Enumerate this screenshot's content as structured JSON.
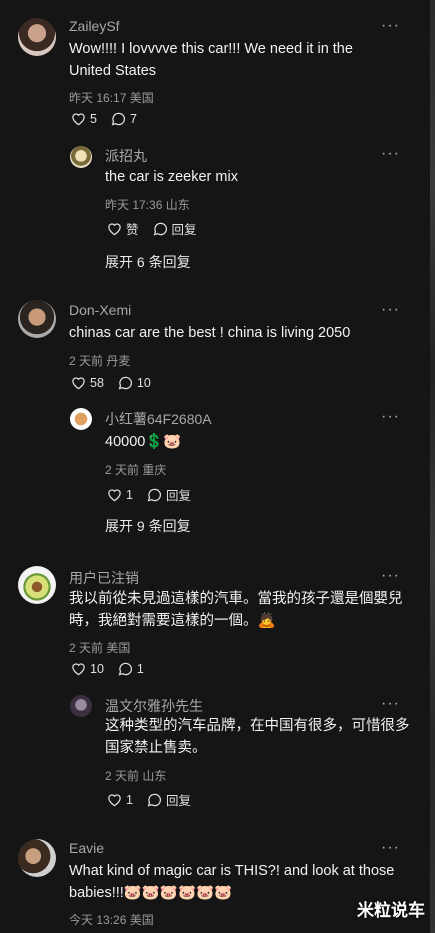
{
  "comments": [
    {
      "user": "ZaileySf",
      "text_line1": "Wow!!!! I lovvvve this car!!! We need it in the",
      "text_line2": "United States",
      "meta": "昨天 16:17 美国",
      "likes": "5",
      "replies": "7",
      "reply": {
        "user": "派招丸",
        "text": "the car is zeeker mix",
        "meta": "昨天 17:36 山东",
        "like_label": "赞",
        "reply_label": "回复"
      },
      "expand": "展开 6 条回复"
    },
    {
      "user": "Don-Xemi",
      "text_line1": "chinas car are the best ! china is living 2050",
      "meta": "2 天前 丹麦",
      "likes": "58",
      "replies": "10",
      "reply": {
        "user": "小红薯64F2680A",
        "text": "40000💲🐷",
        "meta": "2 天前 重庆",
        "likes": "1",
        "reply_label": "回复"
      },
      "expand": "展开 9 条回复"
    },
    {
      "user": "用户已注销",
      "text_line1": "我以前從未見過這樣的汽車。當我的孩子還是個嬰兒",
      "text_line2": "時，我絕對需要這樣的一個。🙇",
      "meta": "2 天前 美国",
      "likes": "10",
      "replies": "1",
      "reply": {
        "user": "温文尔雅孙先生",
        "text_line1": "这种类型的汽车品牌，在中国有很多，可惜很多",
        "text_line2": "国家禁止售卖。",
        "meta": "2 天前 山东",
        "likes": "1",
        "reply_label": "回复"
      }
    },
    {
      "user": "Eavie",
      "text_line1": "What kind of magic car is THIS?! and look at those",
      "text_line2": "babies!!!🐷🐷🐷🐷🐷🐷",
      "meta": "今天 13:26 美国"
    }
  ],
  "more_label": "···",
  "watermark": "米粒说车"
}
